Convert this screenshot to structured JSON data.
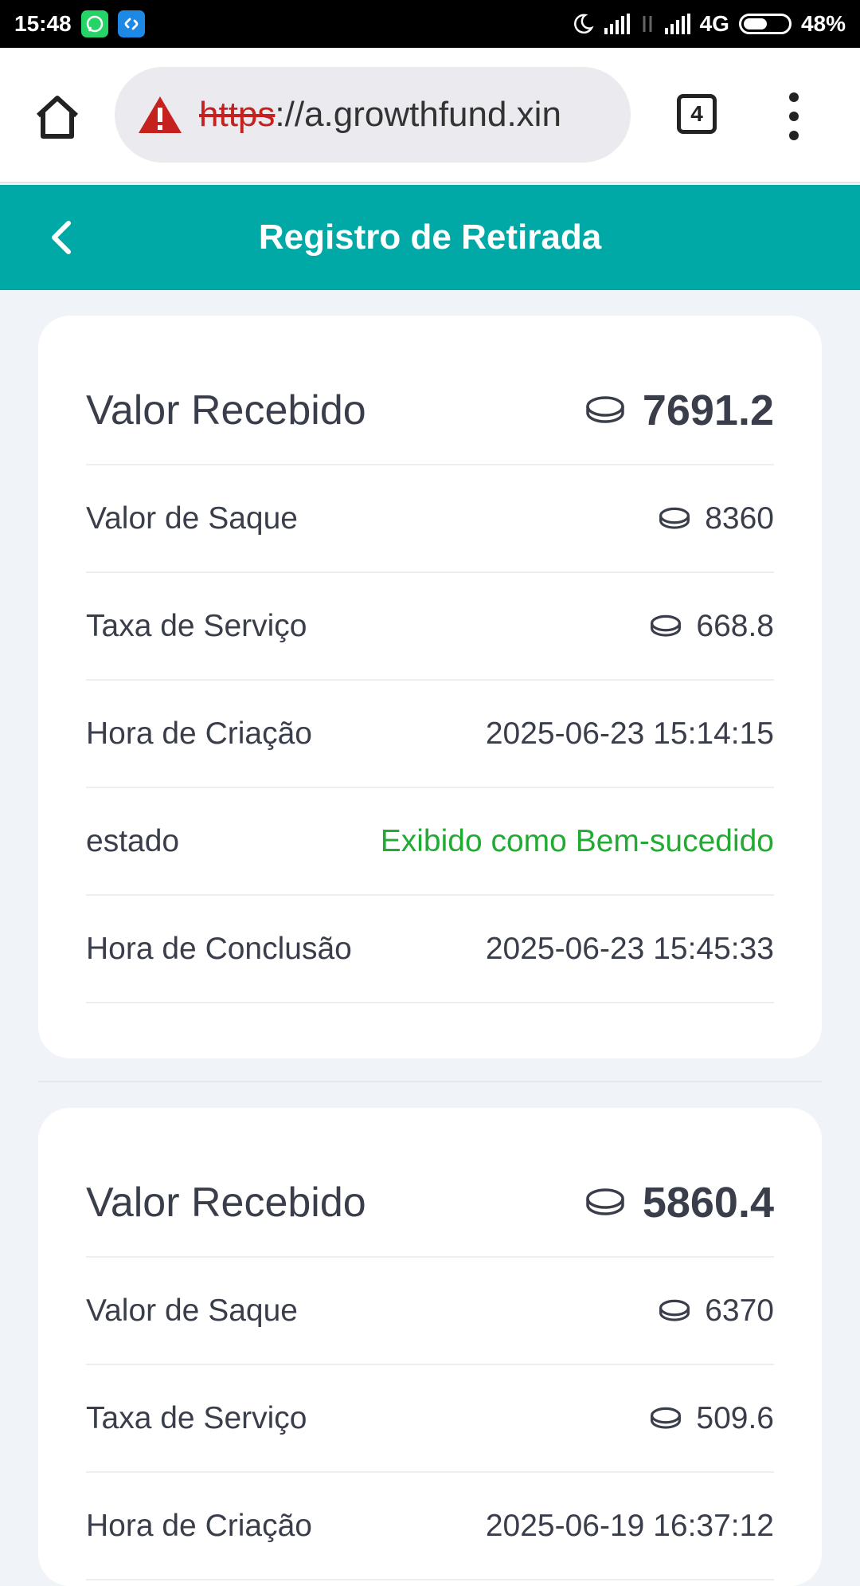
{
  "status_bar": {
    "time": "15:48",
    "network": "4G",
    "battery": "48%"
  },
  "browser": {
    "url_scheme": "https",
    "url_rest": "://a.growthfund.xin",
    "tab_count": "4"
  },
  "header": {
    "title": "Registro de Retirada"
  },
  "records": [
    {
      "received_label": "Valor Recebido",
      "received_value": "7691.2",
      "withdraw_label": "Valor de Saque",
      "withdraw_value": "8360",
      "fee_label": "Taxa de Serviço",
      "fee_value": "668.8",
      "created_label": "Hora de Criação",
      "created_value": "2025-06-23 15:14:15",
      "status_label": "estado",
      "status_value": "Exibido como Bem-sucedido",
      "completed_label": "Hora de Conclusão",
      "completed_value": "2025-06-23 15:45:33"
    },
    {
      "received_label": "Valor Recebido",
      "received_value": "5860.4",
      "withdraw_label": "Valor de Saque",
      "withdraw_value": "6370",
      "fee_label": "Taxa de Serviço",
      "fee_value": "509.6",
      "created_label": "Hora de Criação",
      "created_value": "2025-06-19 16:37:12"
    }
  ],
  "colors": {
    "accent": "#00a9a6",
    "success": "#22ab32",
    "warning": "#c5221f"
  },
  "icons": [
    "whatsapp-icon",
    "shazam-icon",
    "moon-icon",
    "signal-icon",
    "battery-icon",
    "home-icon",
    "warning-icon",
    "tabs-icon",
    "menu-icon",
    "back-icon",
    "coin-icon"
  ]
}
